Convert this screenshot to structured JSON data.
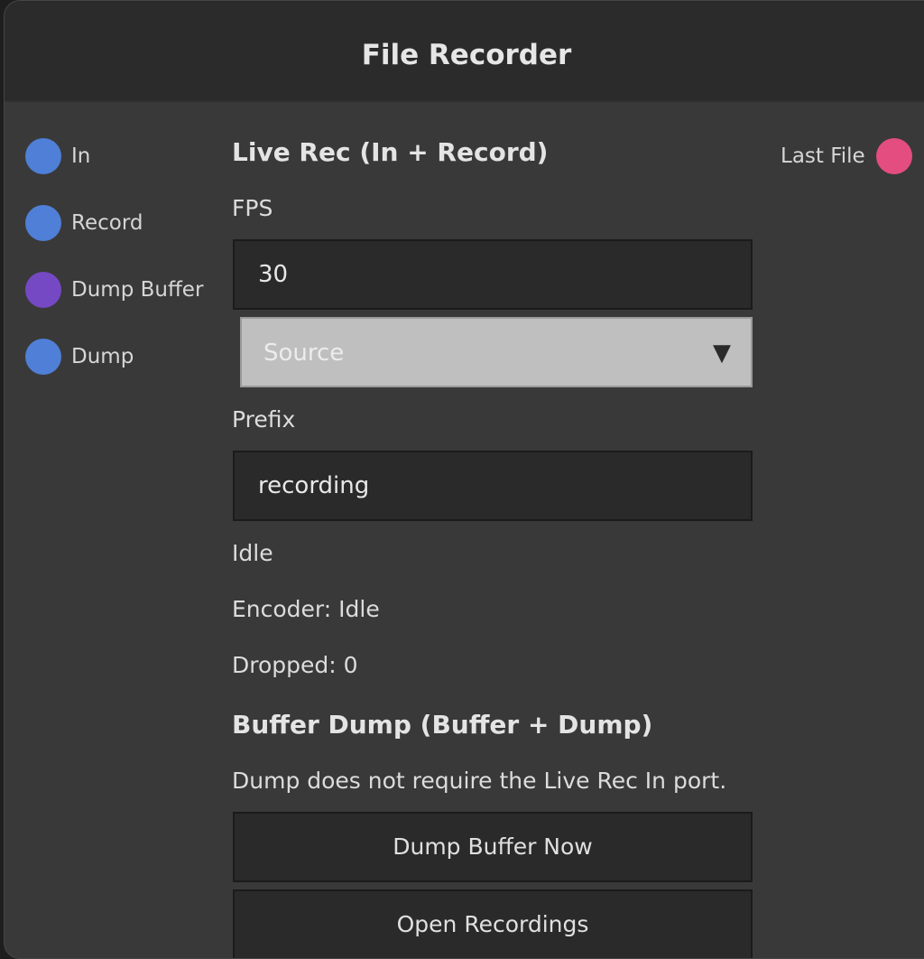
{
  "node": {
    "title": "File Recorder"
  },
  "ports": {
    "inputs": [
      {
        "label": "In",
        "color": "#4f7fd6"
      },
      {
        "label": "Record",
        "color": "#4f7fd6"
      },
      {
        "label": "Dump Buffer",
        "color": "#7549c4"
      },
      {
        "label": "Dump",
        "color": "#4f7fd6"
      }
    ],
    "outputs": [
      {
        "label": "Last File",
        "color": "#e44d80"
      }
    ]
  },
  "live_rec": {
    "title": "Live Rec (In + Record)",
    "fps_label": "FPS",
    "fps_value": "30",
    "source_select": "Source",
    "caret": "▼",
    "prefix_label": "Prefix",
    "prefix_value": "recording",
    "status": "Idle",
    "encoder_status": "Encoder: Idle",
    "dropped": "Dropped: 0"
  },
  "buffer_dump": {
    "title": "Buffer Dump (Buffer + Dump)",
    "note": "Dump does not require the Live Rec In port.",
    "dump_button": "Dump Buffer Now",
    "open_button": "Open Recordings"
  }
}
